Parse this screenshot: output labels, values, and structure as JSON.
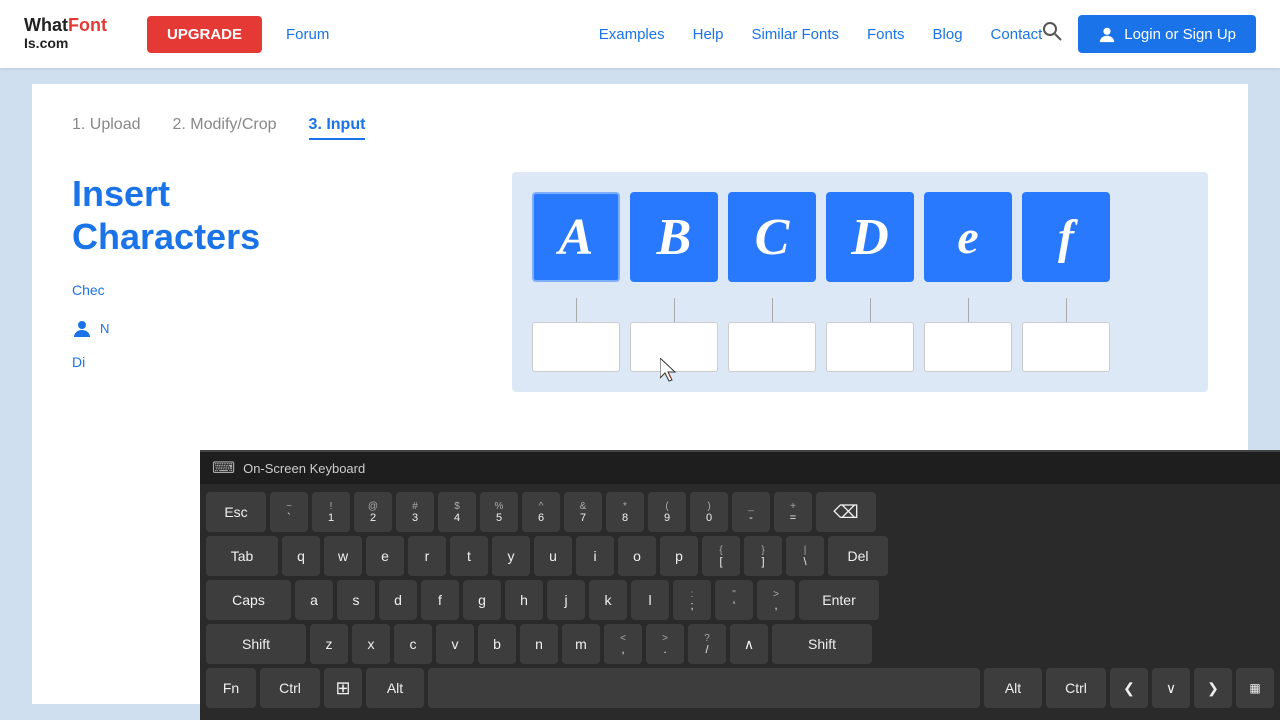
{
  "header": {
    "logo_line1": "WhatFont",
    "logo_line2": "Is.com",
    "upgrade_label": "UPGRADE",
    "nav_items": [
      {
        "label": "Forum",
        "id": "forum"
      },
      {
        "label": "Examples",
        "id": "examples"
      },
      {
        "label": "Help",
        "id": "help"
      },
      {
        "label": "Similar Fonts",
        "id": "similar-fonts"
      },
      {
        "label": "Fonts",
        "id": "fonts"
      },
      {
        "label": "Blog",
        "id": "blog"
      },
      {
        "label": "Contact",
        "id": "contact"
      }
    ],
    "login_label": "Login or Sign Up"
  },
  "steps": [
    {
      "label": "1. Upload",
      "id": "step-upload",
      "state": "inactive"
    },
    {
      "label": "2. Modify/Crop",
      "id": "step-modify",
      "state": "inactive"
    },
    {
      "label": "3. Input",
      "id": "step-input",
      "state": "active"
    }
  ],
  "main": {
    "title_line1": "Insert",
    "title_line2": "Characters",
    "letters": [
      "A",
      "B",
      "C",
      "D",
      "e",
      "f"
    ]
  },
  "keyboard": {
    "title": "On-Screen Keyboard",
    "rows": [
      {
        "keys": [
          {
            "label": "Esc",
            "class": "wide-1"
          },
          {
            "label": "~\n`",
            "sub": "~"
          },
          {
            "label": "!\n1",
            "sub": "!"
          },
          {
            "label": "@\n2",
            "sub": "@"
          },
          {
            "label": "#\n3",
            "sub": "#"
          },
          {
            "label": "$\n4",
            "sub": "$"
          },
          {
            "label": "%\n5",
            "sub": "%"
          },
          {
            "label": "^\n6",
            "sub": "^"
          },
          {
            "label": "&\n7",
            "sub": "&"
          },
          {
            "label": "*\n8",
            "sub": "*"
          },
          {
            "label": "(\n9",
            "sub": "("
          },
          {
            "label": ")\n0",
            "sub": ")"
          },
          {
            "label": "_\n-",
            "sub": "_"
          },
          {
            "label": "+\n=",
            "sub": "+"
          },
          {
            "label": "⌫",
            "class": "wide-backspace icon-key"
          }
        ]
      }
    ]
  }
}
